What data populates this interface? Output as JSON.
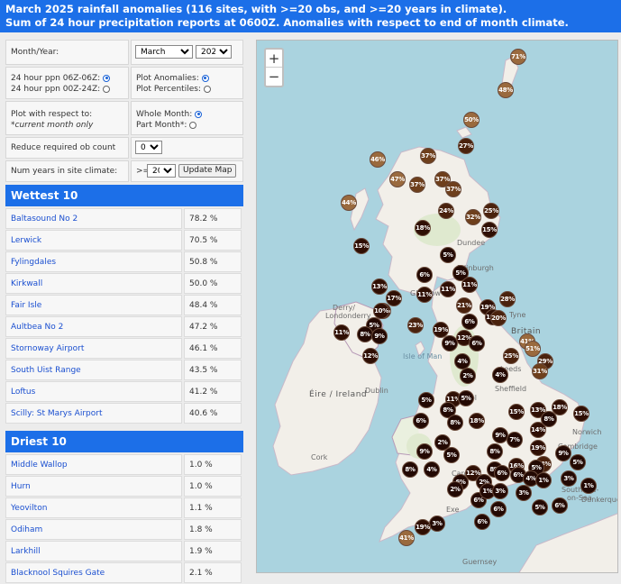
{
  "header": {
    "line1": "March 2025 rainfall anomalies (116 sites, with >=20 obs, and >=20 years in climate).",
    "line2": "Sum of 24 hour precipitation reports at 0600Z. Anomalies with respect to end of month climate."
  },
  "controls": {
    "month_year_label": "Month/Year:",
    "month_value": "March",
    "year_value": "2025",
    "ppn_0606_label": "24 hour ppn 06Z-06Z:",
    "ppn_0024_label": "24 hour ppn 00Z-24Z:",
    "plot_anomalies_label": "Plot Anomalies:",
    "plot_percentiles_label": "Plot Percentiles:",
    "respect_label": "Plot with respect to:",
    "respect_note": "*current month only",
    "whole_month_label": "Whole Month:",
    "part_month_label": "Part Month*:",
    "reduce_label": "Reduce required ob count by:",
    "reduce_value": "0",
    "num_years_label": "Num years in site climate:",
    "num_years_prefix": ">=",
    "num_years_value": "20",
    "update_button": "Update Map"
  },
  "wettest": {
    "title": "Wettest 10",
    "rows": [
      {
        "name": "Baltasound No 2",
        "value": "78.2 %"
      },
      {
        "name": "Lerwick",
        "value": "70.5 %"
      },
      {
        "name": "Fylingdales",
        "value": "50.8 %"
      },
      {
        "name": "Kirkwall",
        "value": "50.0 %"
      },
      {
        "name": "Fair Isle",
        "value": "48.4 %"
      },
      {
        "name": "Aultbea No 2",
        "value": "47.2 %"
      },
      {
        "name": "Stornoway Airport",
        "value": "46.1 %"
      },
      {
        "name": "South Uist Range",
        "value": "43.5 %"
      },
      {
        "name": "Loftus",
        "value": "41.2 %"
      },
      {
        "name": "Scilly: St Marys Airport",
        "value": "40.6 %"
      }
    ]
  },
  "driest": {
    "title": "Driest 10",
    "rows": [
      {
        "name": "Middle Wallop",
        "value": "1.0 %"
      },
      {
        "name": "Hurn",
        "value": "1.0 %"
      },
      {
        "name": "Yeovilton",
        "value": "1.1 %"
      },
      {
        "name": "Odiham",
        "value": "1.8 %"
      },
      {
        "name": "Larkhill",
        "value": "1.9 %"
      },
      {
        "name": "Blacknool Squires Gate",
        "value": "2.1 %"
      }
    ]
  },
  "map": {
    "zoom_in": "+",
    "zoom_out": "−",
    "labels": {
      "britain": "Britain",
      "eire": "Éire / Ireland",
      "dublin": "Dublin",
      "cork": "Cork",
      "isle_of_man": "Isle of Man",
      "derry": "Derry/",
      "londonderry": "Londonderry",
      "edinburgh": "Edinburgh",
      "glasgow": "Glasgow",
      "dundee": "Dundee",
      "tyne": "Tyne",
      "leeds": "Leeds",
      "sheffield": "Sheffield",
      "norwich": "Norwich",
      "cambridge": "Cambridge",
      "cardiff": "Cardiff",
      "southend": "Southend-",
      "on_sea": "on-Sea",
      "dunkerque": "Dunkerque",
      "guernsey": "Guernsey",
      "exeter": "Exe",
      "ool": "ool"
    },
    "markers": [
      {
        "label": "71%",
        "level": 0.71
      },
      {
        "label": "48%",
        "level": 0.48
      },
      {
        "label": "50%",
        "level": 0.5
      },
      {
        "label": "27%",
        "level": 0.27
      },
      {
        "label": "46%",
        "level": 0.46
      },
      {
        "label": "37%",
        "level": 0.37
      },
      {
        "label": "47%",
        "level": 0.47
      },
      {
        "label": "37%",
        "level": 0.37
      },
      {
        "label": "37%",
        "level": 0.37
      },
      {
        "label": "37%",
        "level": 0.37
      },
      {
        "label": "44%",
        "level": 0.44
      },
      {
        "label": "24%",
        "level": 0.24
      },
      {
        "label": "32%",
        "level": 0.32
      },
      {
        "label": "25%",
        "level": 0.25
      },
      {
        "label": "18%",
        "level": 0.18
      },
      {
        "label": "15%",
        "level": 0.15
      },
      {
        "label": "15%",
        "level": 0.15
      },
      {
        "label": "5%",
        "level": 0.05
      },
      {
        "label": "5%",
        "level": 0.05
      },
      {
        "label": "6%",
        "level": 0.06
      },
      {
        "label": "11%",
        "level": 0.11
      },
      {
        "label": "13%",
        "level": 0.13
      },
      {
        "label": "17%",
        "level": 0.17
      },
      {
        "label": "11%",
        "level": 0.11
      },
      {
        "label": "11%",
        "level": 0.11
      },
      {
        "label": "21%",
        "level": 0.21
      },
      {
        "label": "14%",
        "level": 0.14
      },
      {
        "label": "19%",
        "level": 0.19
      },
      {
        "label": "28%",
        "level": 0.28
      },
      {
        "label": "10%",
        "level": 0.1
      },
      {
        "label": "18%",
        "level": 0.18
      },
      {
        "label": "20%",
        "level": 0.2
      },
      {
        "label": "6%",
        "level": 0.06
      },
      {
        "label": "23%",
        "level": 0.23
      },
      {
        "label": "5%",
        "level": 0.05
      },
      {
        "label": "11%",
        "level": 0.11
      },
      {
        "label": "8%",
        "level": 0.08
      },
      {
        "label": "9%",
        "level": 0.09
      },
      {
        "label": "19%",
        "level": 0.19
      },
      {
        "label": "9%",
        "level": 0.09
      },
      {
        "label": "12%",
        "level": 0.12
      },
      {
        "label": "6%",
        "level": 0.06
      },
      {
        "label": "41%",
        "level": 0.41
      },
      {
        "label": "25%",
        "level": 0.25
      },
      {
        "label": "51%",
        "level": 0.51
      },
      {
        "label": "12%",
        "level": 0.12
      },
      {
        "label": "4%",
        "level": 0.04
      },
      {
        "label": "29%",
        "level": 0.29
      },
      {
        "label": "2%",
        "level": 0.02
      },
      {
        "label": "4%",
        "level": 0.04
      },
      {
        "label": "31%",
        "level": 0.31
      },
      {
        "label": "5%",
        "level": 0.05
      },
      {
        "label": "11%",
        "level": 0.11
      },
      {
        "label": "5%",
        "level": 0.05
      },
      {
        "label": "8%",
        "level": 0.08
      },
      {
        "label": "15%",
        "level": 0.15
      },
      {
        "label": "13%",
        "level": 0.13
      },
      {
        "label": "8%",
        "level": 0.08
      },
      {
        "label": "18%",
        "level": 0.18
      },
      {
        "label": "6%",
        "level": 0.06
      },
      {
        "label": "8%",
        "level": 0.08
      },
      {
        "label": "18%",
        "level": 0.18
      },
      {
        "label": "15%",
        "level": 0.15
      },
      {
        "label": "14%",
        "level": 0.14
      },
      {
        "label": "9%",
        "level": 0.09
      },
      {
        "label": "7%",
        "level": 0.07
      },
      {
        "label": "2%",
        "level": 0.02
      },
      {
        "label": "19%",
        "level": 0.19
      },
      {
        "label": "9%",
        "level": 0.09
      },
      {
        "label": "5%",
        "level": 0.05
      },
      {
        "label": "8%",
        "level": 0.08
      },
      {
        "label": "9%",
        "level": 0.09
      },
      {
        "label": "5%",
        "level": 0.05
      },
      {
        "label": "12%",
        "level": 0.12
      },
      {
        "label": "16%",
        "level": 0.16
      },
      {
        "label": "24%",
        "level": 0.24
      },
      {
        "label": "8%",
        "level": 0.08
      },
      {
        "label": "4%",
        "level": 0.04
      },
      {
        "label": "6%",
        "level": 0.06
      },
      {
        "label": "2%",
        "level": 0.02
      },
      {
        "label": "8%",
        "level": 0.08
      },
      {
        "label": "6%",
        "level": 0.06
      },
      {
        "label": "6%",
        "level": 0.06
      },
      {
        "label": "5%",
        "level": 0.05
      },
      {
        "label": "4%",
        "level": 0.04
      },
      {
        "label": "1%",
        "level": 0.01
      },
      {
        "label": "3%",
        "level": 0.03
      },
      {
        "label": "1%",
        "level": 0.01
      },
      {
        "label": "2%",
        "level": 0.02
      },
      {
        "label": "6%",
        "level": 0.06
      },
      {
        "label": "1%",
        "level": 0.01
      },
      {
        "label": "3%",
        "level": 0.03
      },
      {
        "label": "3%",
        "level": 0.03
      },
      {
        "label": "6%",
        "level": 0.06
      },
      {
        "label": "5%",
        "level": 0.05
      },
      {
        "label": "6%",
        "level": 0.06
      },
      {
        "label": "6%",
        "level": 0.06
      },
      {
        "label": "3%",
        "level": 0.03
      },
      {
        "label": "19%",
        "level": 0.19
      },
      {
        "label": "41%",
        "level": 0.41
      }
    ]
  }
}
